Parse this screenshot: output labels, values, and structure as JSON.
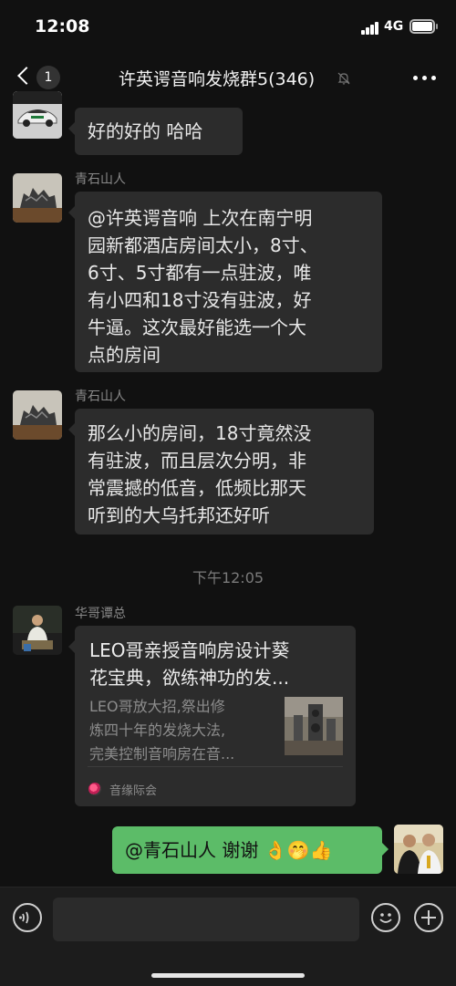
{
  "status_bar": {
    "time": "12:08",
    "network": "4G",
    "icons": [
      "signal-icon",
      "battery-icon"
    ]
  },
  "nav": {
    "unread_count": "1",
    "title": "许英谔音响发烧群5(346)",
    "icons": [
      "back-chevron-icon",
      "mute-bell-icon",
      "more-dots-icon"
    ]
  },
  "messages": [
    {
      "type": "text",
      "sender": "",
      "avatar": "sports-car-avatar",
      "text": "好的好的 哈哈"
    },
    {
      "type": "text",
      "sender": "青石山人",
      "avatar": "rock-sculpture-avatar",
      "lines": [
        "@许英谔音响 上次在南宁明",
        "园新都酒店房间太小，8寸、",
        "6寸、5寸都有一点驻波，唯",
        "有小四和18寸没有驻波，好",
        "牛逼。这次最好能选一个大",
        "点的房间"
      ]
    },
    {
      "type": "text",
      "sender": "青石山人",
      "avatar": "rock-sculpture-avatar",
      "lines": [
        "那么小的房间，18寸竟然没",
        "有驻波，而且层次分明，非",
        "常震撼的低音，低频比那天",
        "听到的大乌托邦还好听"
      ]
    }
  ],
  "timestamp": "下午12:05",
  "share_card": {
    "sender": "华哥谭总",
    "avatar": "man-seated-avatar",
    "title_lines": [
      "LEO哥亲授音响房设计葵",
      "花宝典，欲练神功的发..."
    ],
    "desc_lines": [
      "LEO哥放大招,祭出修",
      "炼四十年的发烧大法,",
      "完美控制音响房在音..."
    ],
    "thumbnail": "speaker-room-thumbnail",
    "source": "音缘际会",
    "source_icon": "source-logo-icon"
  },
  "my_message": {
    "text": "@青石山人 谢谢",
    "emoji": [
      "👌",
      "🤭",
      "👍"
    ],
    "avatar": "two-men-avatar"
  },
  "input_bar": {
    "placeholder": "",
    "icons": [
      "voice-icon",
      "emoji-icon",
      "plus-icon"
    ]
  },
  "colors": {
    "background": "#111111",
    "bubble_other": "#2c2c2c",
    "bubble_mine": "#5cbc68",
    "input_bar": "#1c1c1c"
  }
}
